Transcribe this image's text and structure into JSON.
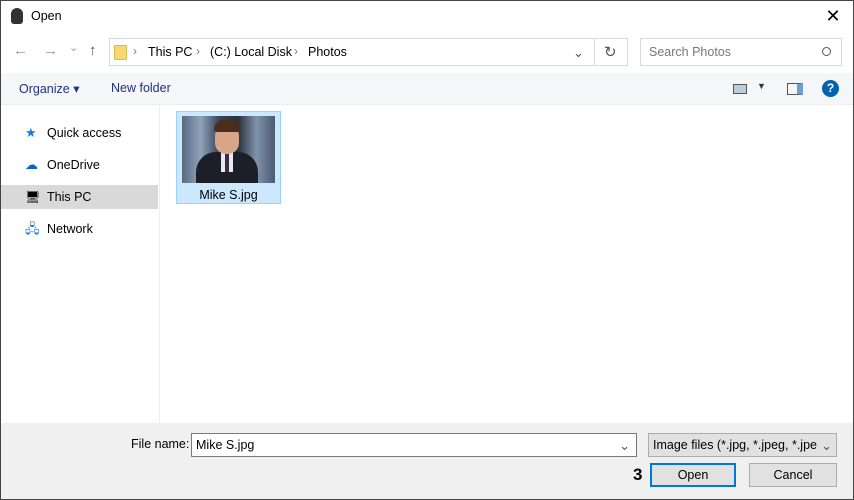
{
  "window": {
    "title": "Open",
    "close": "✕"
  },
  "nav": {
    "back": "←",
    "forward": "→",
    "recent": "⌄",
    "up": "↑"
  },
  "address": {
    "crumbs": [
      "This PC",
      "(C:) Local Disk",
      "Photos"
    ],
    "refresh": "↻",
    "dropdown": "⌄"
  },
  "search": {
    "placeholder": "Search Photos"
  },
  "toolbar": {
    "organize": "Organize ▾",
    "new_folder": "New folder",
    "help": "?"
  },
  "sidebar": {
    "items": [
      {
        "label": "Quick access",
        "icon": "★"
      },
      {
        "label": "OneDrive",
        "icon": "☁"
      },
      {
        "label": "This PC",
        "icon": "🖥"
      },
      {
        "label": "Network",
        "icon": "🖧"
      }
    ],
    "selected": "This PC"
  },
  "files": [
    {
      "name": "Mike S.jpg",
      "selected": true
    }
  ],
  "bottom": {
    "file_name_label": "File name:",
    "file_name_value": "Mike S.jpg",
    "filter": "Image files (*.jpg, *.jpeg, *.jpe, *",
    "open": "Open",
    "cancel": "Cancel",
    "step_marker": "3"
  },
  "colors": {
    "accent": "#0078d7",
    "selection": "#cce8ff"
  }
}
